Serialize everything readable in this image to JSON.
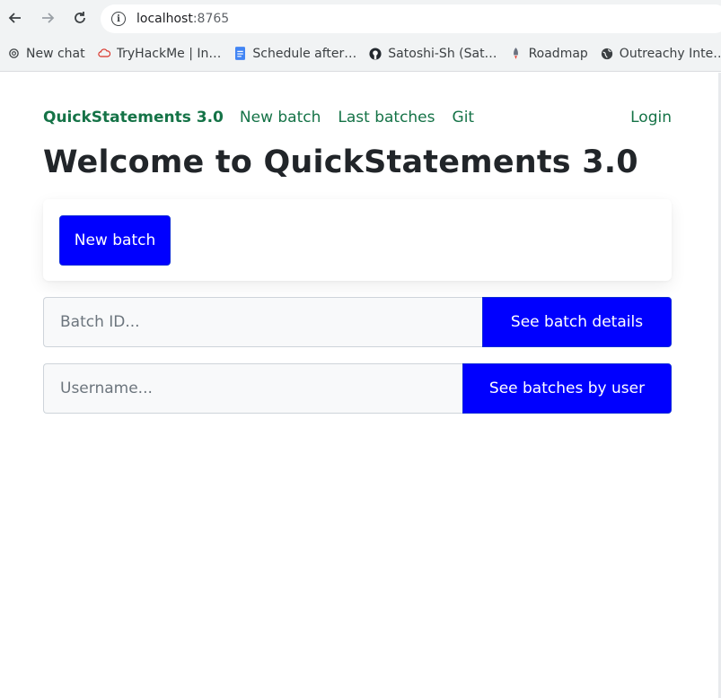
{
  "browser": {
    "url_host": "localhost",
    "url_port": ":8765",
    "bookmarks": [
      {
        "label": "New chat",
        "icon": "openai-icon"
      },
      {
        "label": "TryHackMe | In…",
        "icon": "cloud-icon"
      },
      {
        "label": "Schedule after…",
        "icon": "docs-icon"
      },
      {
        "label": "Satoshi-Sh (Sat…",
        "icon": "github-icon"
      },
      {
        "label": "Roadmap",
        "icon": "rocket-icon"
      },
      {
        "label": "Outreachy Inte…",
        "icon": "globe-icon"
      }
    ]
  },
  "nav": {
    "brand": "QuickStatements 3.0",
    "links": [
      "New batch",
      "Last batches",
      "Git"
    ],
    "login": "Login"
  },
  "main": {
    "title": "Welcome to QuickStatements 3.0",
    "new_batch_button": "New batch",
    "batch_id": {
      "placeholder": "Batch ID...",
      "button": "See batch details"
    },
    "username": {
      "placeholder": "Username...",
      "button": "See batches by user"
    }
  },
  "colors": {
    "link_green": "#157347",
    "primary_button": "#0000ff",
    "title_text": "#212529"
  }
}
